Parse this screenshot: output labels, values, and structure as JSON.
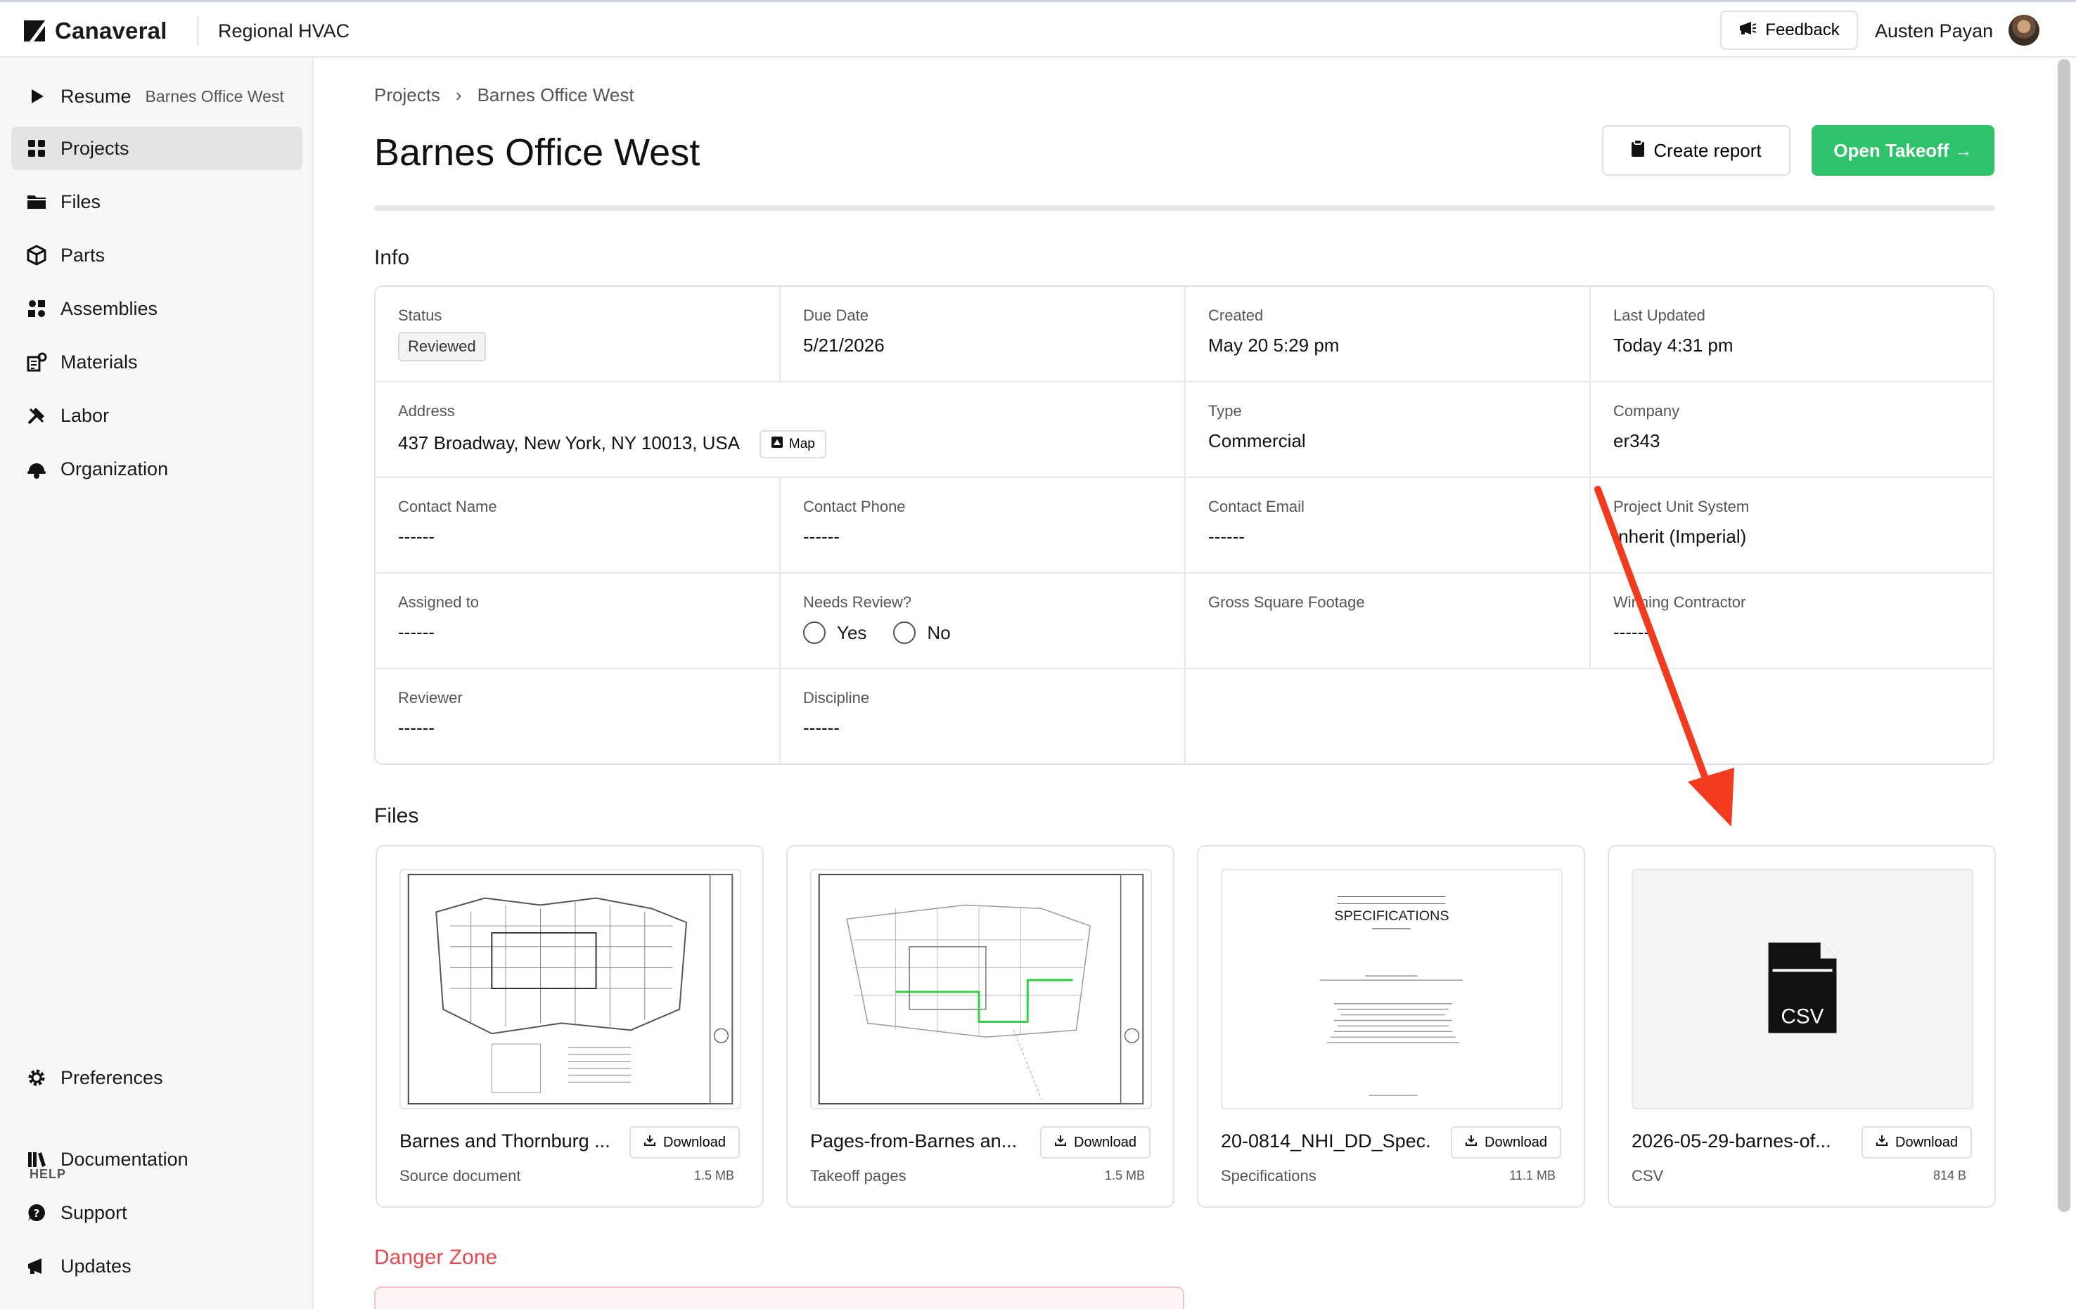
{
  "app": {
    "name": "Canaveral",
    "org": "Regional HVAC"
  },
  "topbar": {
    "feedback_label": "Feedback",
    "user_name": "Austen Payan"
  },
  "sidebar": {
    "resume_label": "Resume",
    "resume_sub": "Barnes Office West",
    "items": [
      {
        "label": "Projects",
        "icon": "grid-icon"
      },
      {
        "label": "Files",
        "icon": "folder-icon"
      },
      {
        "label": "Parts",
        "icon": "cube-icon"
      },
      {
        "label": "Assemblies",
        "icon": "assemblies-icon"
      },
      {
        "label": "Materials",
        "icon": "materials-icon"
      },
      {
        "label": "Labor",
        "icon": "tools-icon"
      },
      {
        "label": "Organization",
        "icon": "helmet-icon"
      }
    ],
    "preferences_label": "Preferences",
    "help_label": "HELP",
    "help_items": [
      {
        "label": "Documentation",
        "icon": "book-icon"
      },
      {
        "label": "Support",
        "icon": "chat-icon"
      },
      {
        "label": "Updates",
        "icon": "megaphone-icon"
      }
    ]
  },
  "breadcrumb": {
    "root": "Projects",
    "separator": "›",
    "current": "Barnes Office West"
  },
  "page": {
    "title": "Barnes Office West",
    "create_report_label": "Create report",
    "open_takeoff_label": "Open Takeoff →"
  },
  "info": {
    "title": "Info",
    "status_label": "Status",
    "status_value": "Reviewed",
    "due_date_label": "Due Date",
    "due_date_value": "5/21/2026",
    "created_label": "Created",
    "created_value": "May 20 5:29 pm",
    "last_updated_label": "Last Updated",
    "last_updated_value": "Today 4:31 pm",
    "address_label": "Address",
    "address_value": "437 Broadway, New York, NY 10013, USA",
    "map_label": "Map",
    "type_label": "Type",
    "type_value": "Commercial",
    "company_label": "Company",
    "company_value": "er343",
    "contact_name_label": "Contact Name",
    "contact_name_value": "------",
    "contact_phone_label": "Contact Phone",
    "contact_phone_value": "------",
    "contact_email_label": "Contact Email",
    "contact_email_value": "------",
    "unit_system_label": "Project Unit System",
    "unit_system_value": "Inherit (Imperial)",
    "assigned_label": "Assigned to",
    "assigned_value": "------",
    "needs_review_label": "Needs Review?",
    "yes_label": "Yes",
    "no_label": "No",
    "gross_sqft_label": "Gross Square Footage",
    "winning_contractor_label": "Winning Contractor",
    "winning_contractor_value": "------",
    "reviewer_label": "Reviewer",
    "reviewer_value": "------",
    "discipline_label": "Discipline",
    "discipline_value": "------"
  },
  "files": {
    "title": "Files",
    "download_label": "Download",
    "items": [
      {
        "name": "Barnes and Thornburg ...",
        "type": "Source document",
        "size": "1.5 MB"
      },
      {
        "name": "Pages-from-Barnes an...",
        "type": "Takeoff pages",
        "size": "1.5 MB"
      },
      {
        "name": "20-0814_NHI_DD_Spec...",
        "type": "Specifications",
        "size": "11.1 MB"
      },
      {
        "name": "2026-05-29-barnes-of...",
        "type": "CSV",
        "size": "814 B"
      }
    ],
    "spec_thumb_title": "SPECIFICATIONS",
    "csv_badge": "CSV"
  },
  "danger": {
    "title": "Danger Zone"
  },
  "colors": {
    "accent_green": "#2ec26a",
    "danger_red": "#e5484d",
    "annotation_arrow": "#f23a1e"
  }
}
